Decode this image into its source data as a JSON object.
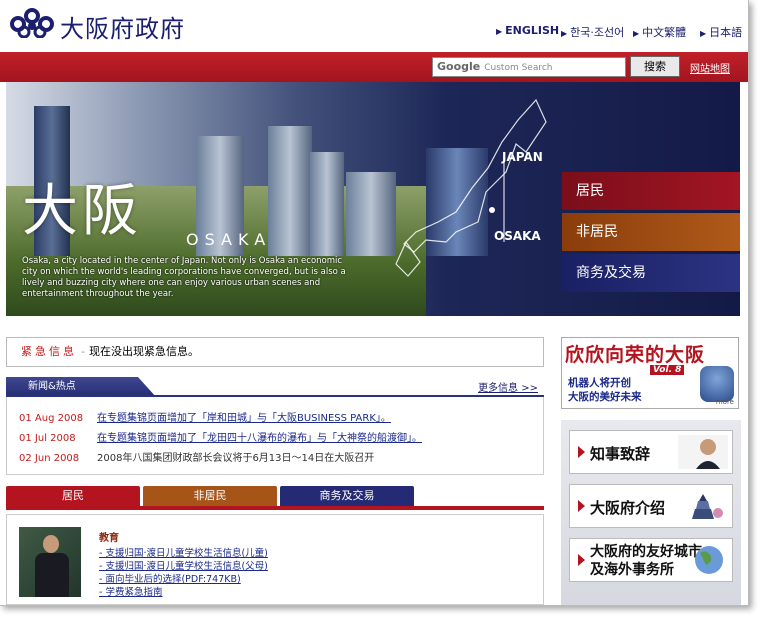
{
  "header": {
    "site_title": "大阪府政府",
    "languages": [
      "ENGLISH",
      "한국·조선어",
      "中文繁體",
      "日本語"
    ]
  },
  "search": {
    "placeholder": "Custom Search",
    "google_label": "Google",
    "button_label": "搜索",
    "sitemap_label": "网站地图"
  },
  "hero": {
    "kanji": "大阪",
    "osaka_en": "OSAKA",
    "description": "Osaka, a city located in the center of Japan. Not only is Osaka an economic city on which the world's leading corporations have converged, but is also a lively and buzzing city where one can enjoy various urban scenes and entertainment throughout the year.",
    "map_japan": "JAPAN",
    "map_osaka": "OSAKA",
    "menu": [
      "居民",
      "非居民",
      "商务及交易"
    ]
  },
  "emergency": {
    "label": "紧急信息",
    "text": "现在没出现紧急信息。"
  },
  "news": {
    "tab_label": "新闻&热点",
    "more_label": "更多信息 >>",
    "items": [
      {
        "date": "01 Aug 2008",
        "text": "在专题集锦页面增加了「岸和田城」与「大阪BUSINESS PARK」。",
        "link": true
      },
      {
        "date": "01 Jul 2008",
        "text": "在专题集锦页面增加了「龙田四十八瀑布的瀑布」与「大神祭的船渡御」。",
        "link": true
      },
      {
        "date": "02 Jun 2008",
        "text": "2008年八国集团财政部长会议将于6月13日～14日在大阪召开",
        "link": false
      }
    ]
  },
  "tabs": {
    "labels": [
      "居民",
      "非居民",
      "商务及交易"
    ],
    "category": "教育",
    "links": [
      "支援归国·渡日儿童学校生活信息(儿童)",
      "支援归国·渡日儿童学校生活信息(父母)",
      "面向毕业后的选择(PDF:747KB)",
      "学费紧急指南"
    ]
  },
  "banner": {
    "title": "欣欣向荣的大阪",
    "vol": "Vol. 8",
    "line1": "机器人将开创",
    "line2": "大阪的美好未来",
    "more": "more"
  },
  "right_links": [
    "知事致辞",
    "大阪府介绍",
    "大阪府的友好城市",
    "及海外事务所"
  ],
  "colors": {
    "brand_navy": "#1b1f6e",
    "brand_red": "#b3141f",
    "brand_orange": "#a65418"
  }
}
